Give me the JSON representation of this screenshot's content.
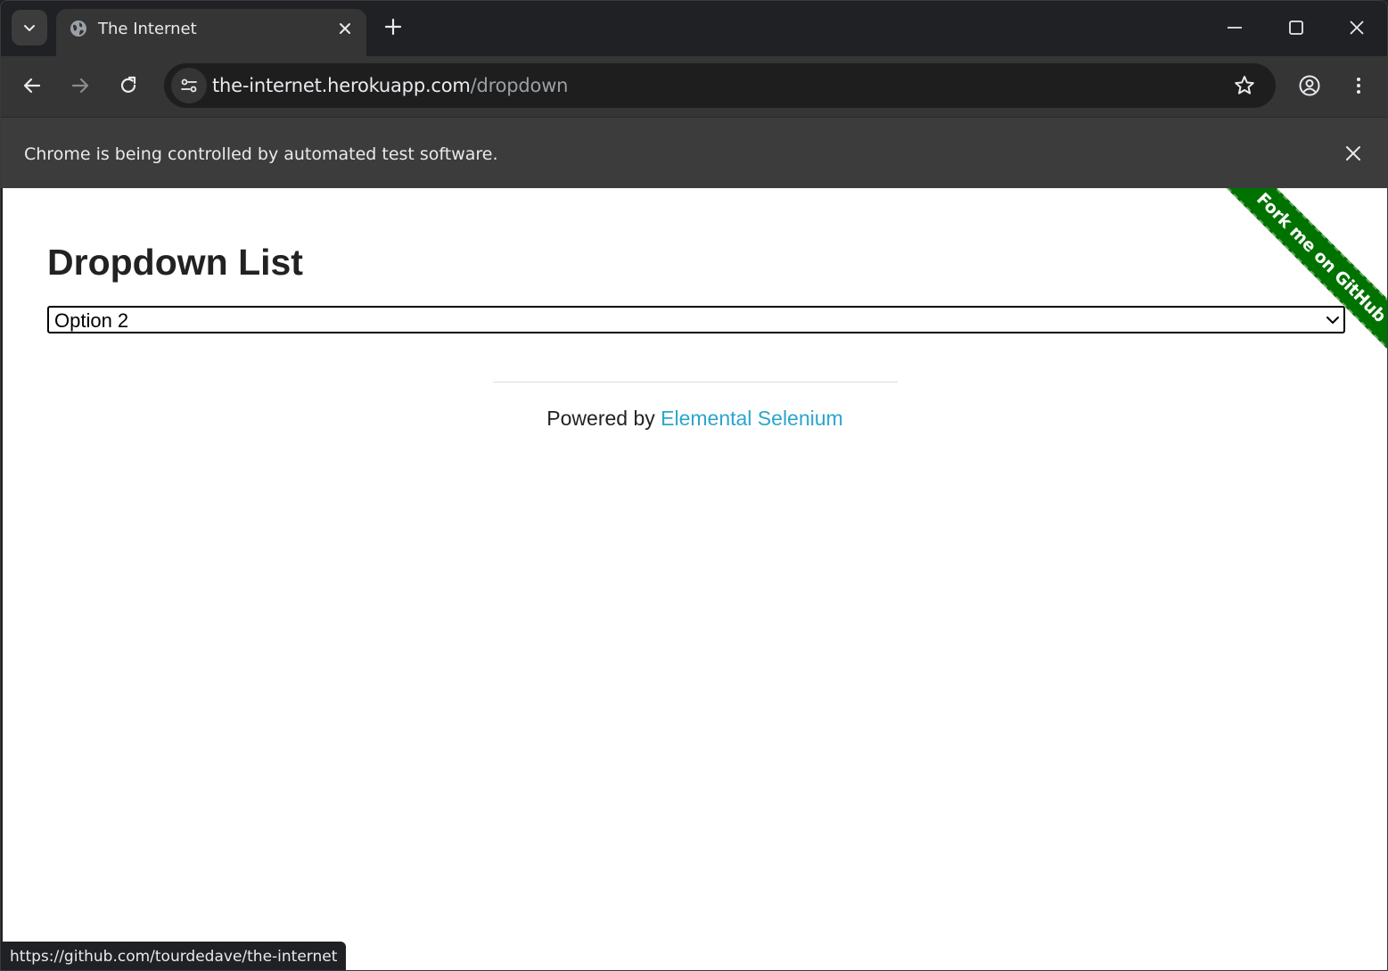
{
  "browser": {
    "tab": {
      "title": "The Internet",
      "favicon": "globe-icon"
    },
    "address": {
      "host": "the-internet.herokuapp.com",
      "path": "/dropdown"
    },
    "infobar": {
      "message": "Chrome is being controlled by automated test software."
    },
    "status_url": "https://github.com/tourdedave/the-internet"
  },
  "page": {
    "heading": "Dropdown List",
    "dropdown": {
      "selected": "Option 2"
    },
    "footer": {
      "prefix": "Powered by ",
      "link_text": "Elemental Selenium"
    },
    "ribbon": {
      "text": "Fork me on GitHub",
      "color": "#007200"
    }
  },
  "colors": {
    "link": "#2ba6cb",
    "chrome_dark": "#202124",
    "toolbar": "#353535",
    "infobar": "#3c3c3c"
  }
}
